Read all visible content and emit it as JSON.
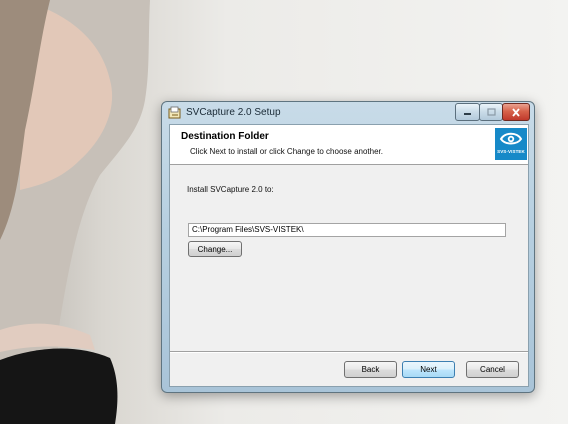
{
  "window": {
    "title": "SVCapture 2.0 Setup",
    "accent_color": "#1689c8"
  },
  "header": {
    "title": "Destination Folder",
    "subtitle": "Click Next to install or click Change to choose another.",
    "logo_text": "SVS-VISTEK"
  },
  "body": {
    "install_label": "Install SVCapture 2.0 to:",
    "install_path": "C:\\Program Files\\SVS-VISTEK\\",
    "change_label": "Change..."
  },
  "footer": {
    "back_label": "Back",
    "next_label": "Next",
    "cancel_label": "Cancel"
  }
}
